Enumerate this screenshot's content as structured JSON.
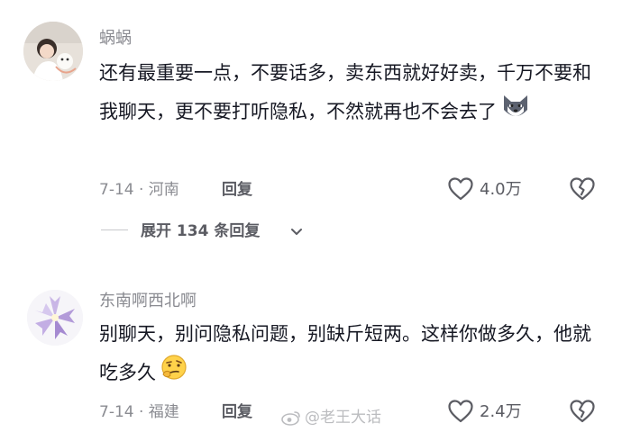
{
  "comments": [
    {
      "username": "蜗蜗",
      "text": "还有最重要一点，不要话多，卖东西就好好卖，千万不要和我聊天，更不要打听隐私，不然就再也不会去了",
      "emoji": "wolf-face-emoji",
      "date_location": "7-14 · 河南",
      "reply_label": "回复",
      "like_count": "4.0万",
      "expand_replies": "展开 134 条回复"
    },
    {
      "username": "东南啊西北啊",
      "text": "别聊天，别问隐私问题，别缺斤短两。这样你做多久，他就吃多久",
      "emoji": "thinking-face-emoji",
      "date_location": "7-14 · 福建",
      "reply_label": "回复",
      "like_count": "2.4万"
    }
  ],
  "watermark": "@老王大话",
  "colors": {
    "text_primary": "#161823",
    "text_secondary": "#8a8b91",
    "icon_gray": "#5b5c63"
  }
}
